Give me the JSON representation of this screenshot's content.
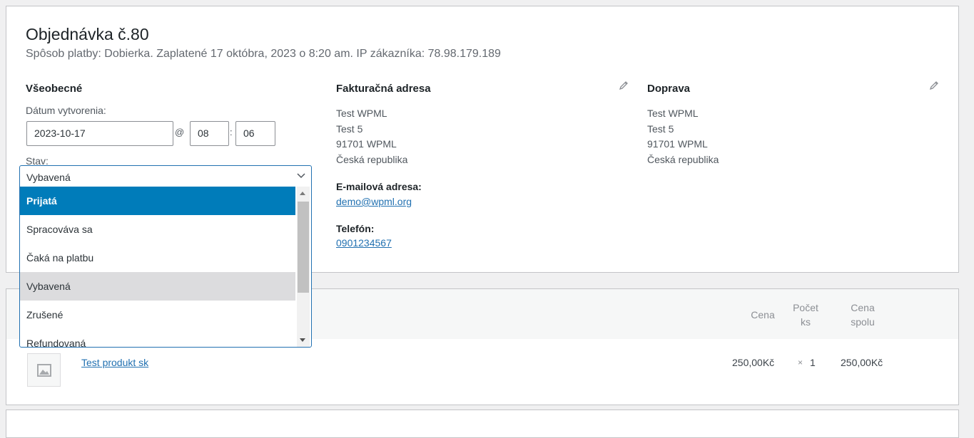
{
  "order": {
    "title": "Objednávka č.80",
    "subtitle": "Spôsob platby: Dobierka. Zaplatené 17 októbra, 2023 o 8:20 am. IP zákazníka: 78.98.179.189"
  },
  "general": {
    "heading": "Všeobecné",
    "date_label": "Dátum vytvorenia:",
    "date_value": "2023-10-17",
    "at_sign": "@",
    "hour": "08",
    "colon": ":",
    "minute": "06",
    "status_label": "Stav:",
    "status_value": "Vybavená",
    "status_options": [
      "Prijatá",
      "Spracováva sa",
      "Čaká na platbu",
      "Vybavená",
      "Zrušené",
      "Refundovaná"
    ]
  },
  "billing": {
    "heading": "Fakturačná adresa",
    "lines": [
      "Test WPML",
      "Test 5",
      "91701 WPML",
      "Česká republika"
    ],
    "email_label": "E-mailová adresa:",
    "email": "demo@wpml.org",
    "phone_label": "Telefón:",
    "phone": "0901234567"
  },
  "shipping": {
    "heading": "Doprava",
    "lines": [
      "Test WPML",
      "Test 5",
      "91701 WPML",
      "Česká republika"
    ]
  },
  "items": {
    "col_price": "Cena",
    "col_qty_1": "Počet",
    "col_qty_2": "ks",
    "col_total_1": "Cena",
    "col_total_2": "spolu",
    "row": {
      "name": "Test produkt sk",
      "price": "250,00Kč",
      "times": "×",
      "qty": "1",
      "total": "250,00Kč"
    }
  },
  "colors": {
    "accent": "#2271b1",
    "selected": "#007cba",
    "hover": "#dcdcde"
  },
  "icons": [
    "pencil-icon",
    "chevron-down-icon",
    "image-placeholder-icon"
  ]
}
